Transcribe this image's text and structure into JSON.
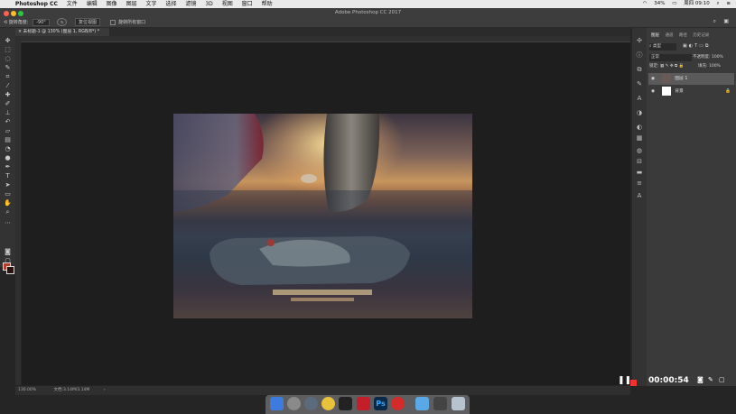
{
  "menubar": {
    "app_name": "Photoshop CC",
    "items": [
      "文件",
      "编辑",
      "图像",
      "图层",
      "文字",
      "选择",
      "滤镜",
      "3D",
      "视图",
      "窗口",
      "帮助"
    ],
    "battery": "34%",
    "clock": "周四 09:10"
  },
  "window_title": "Adobe Photoshop CC 2017",
  "options_bar": {
    "angle_label": "旋转角度:",
    "angle_value": "-90°",
    "reset_label": "复位视图",
    "rotate_all_label": "旋转所有窗口"
  },
  "document_tab": "未标题-1 @ 130% (图层 1, RGB/8*) *",
  "status": {
    "zoom": "130.00%",
    "doc_size": "文档:3.14M/3.14M"
  },
  "layers_panel": {
    "tabs": [
      "图层",
      "通道",
      "路径",
      "历史记录"
    ],
    "filter_label": "类型",
    "blend_mode": "正常",
    "opacity_label": "不透明度:",
    "opacity_value": "100%",
    "lock_label": "锁定:",
    "fill_label": "填充:",
    "fill_value": "100%",
    "layers": [
      {
        "name": "图层 1"
      },
      {
        "name": "背景"
      }
    ]
  },
  "recorder": {
    "time": "00:00:54"
  }
}
